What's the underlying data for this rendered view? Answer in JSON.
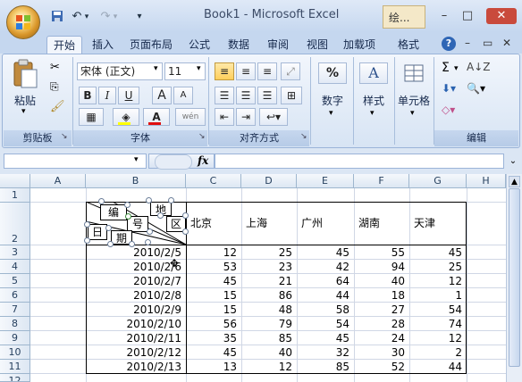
{
  "window": {
    "title": "Book1 - Microsoft Excel",
    "context_tab_label": "绘...",
    "controls": {
      "minimize": "–",
      "maximize": "□",
      "close": "✕"
    },
    "inner_controls": {
      "help": "?",
      "minimize": "–",
      "restore": "▭",
      "close": "✕"
    }
  },
  "quick_access": {
    "save": "save-icon",
    "undo": "undo-icon",
    "redo": "redo-icon",
    "customize": "▾"
  },
  "tabs": [
    {
      "label": "开始",
      "active": true
    },
    {
      "label": "插入"
    },
    {
      "label": "页面布局"
    },
    {
      "label": "公式"
    },
    {
      "label": "数据"
    },
    {
      "label": "审阅"
    },
    {
      "label": "视图"
    },
    {
      "label": "加载项"
    },
    {
      "label": "格式"
    }
  ],
  "ribbon": {
    "clipboard": {
      "group_label": "剪贴板",
      "paste_label": "粘贴"
    },
    "font": {
      "group_label": "字体",
      "font_name": "宋体 (正文)",
      "font_size": "11",
      "bold": "B",
      "italic": "I",
      "underline": "U",
      "grow": "A",
      "shrink": "A",
      "color_letter": "A",
      "phonetic": "wén"
    },
    "alignment": {
      "group_label": "对齐方式"
    },
    "number": {
      "label": "数字",
      "symbol": "%"
    },
    "styles": {
      "label": "样式",
      "symbol": "A"
    },
    "cells": {
      "label": "单元格"
    },
    "editing": {
      "group_label": "编辑",
      "sum": "Σ"
    }
  },
  "formula_bar": {
    "fx": "fx",
    "name_box": "",
    "formula": ""
  },
  "columns": [
    "A",
    "B",
    "C",
    "D",
    "E",
    "F",
    "G",
    "H"
  ],
  "rows": [
    "1",
    "2",
    "3",
    "4",
    "5",
    "6",
    "7",
    "8",
    "9",
    "10",
    "11",
    "12"
  ],
  "header_row": [
    "北京",
    "上海",
    "广州",
    "湖南",
    "天津"
  ],
  "text_boxes": {
    "bian": "编",
    "hao": "号",
    "di": "地",
    "qu": "区",
    "ri": "日",
    "qi": "期"
  },
  "table": [
    {
      "date": "2010/2/5",
      "values": [
        12,
        25,
        45,
        55,
        45
      ]
    },
    {
      "date": "2010/2/6",
      "values": [
        53,
        23,
        42,
        94,
        25
      ]
    },
    {
      "date": "2010/2/7",
      "values": [
        45,
        21,
        64,
        40,
        12
      ]
    },
    {
      "date": "2010/2/8",
      "values": [
        15,
        86,
        44,
        18,
        1
      ]
    },
    {
      "date": "2010/2/9",
      "values": [
        15,
        48,
        58,
        27,
        54
      ]
    },
    {
      "date": "2010/2/10",
      "values": [
        56,
        79,
        54,
        28,
        74
      ]
    },
    {
      "date": "2010/2/11",
      "values": [
        35,
        85,
        45,
        24,
        12
      ]
    },
    {
      "date": "2010/2/12",
      "values": [
        45,
        40,
        32,
        30,
        2
      ]
    },
    {
      "date": "2010/2/13",
      "values": [
        13,
        12,
        85,
        52,
        44
      ]
    }
  ]
}
